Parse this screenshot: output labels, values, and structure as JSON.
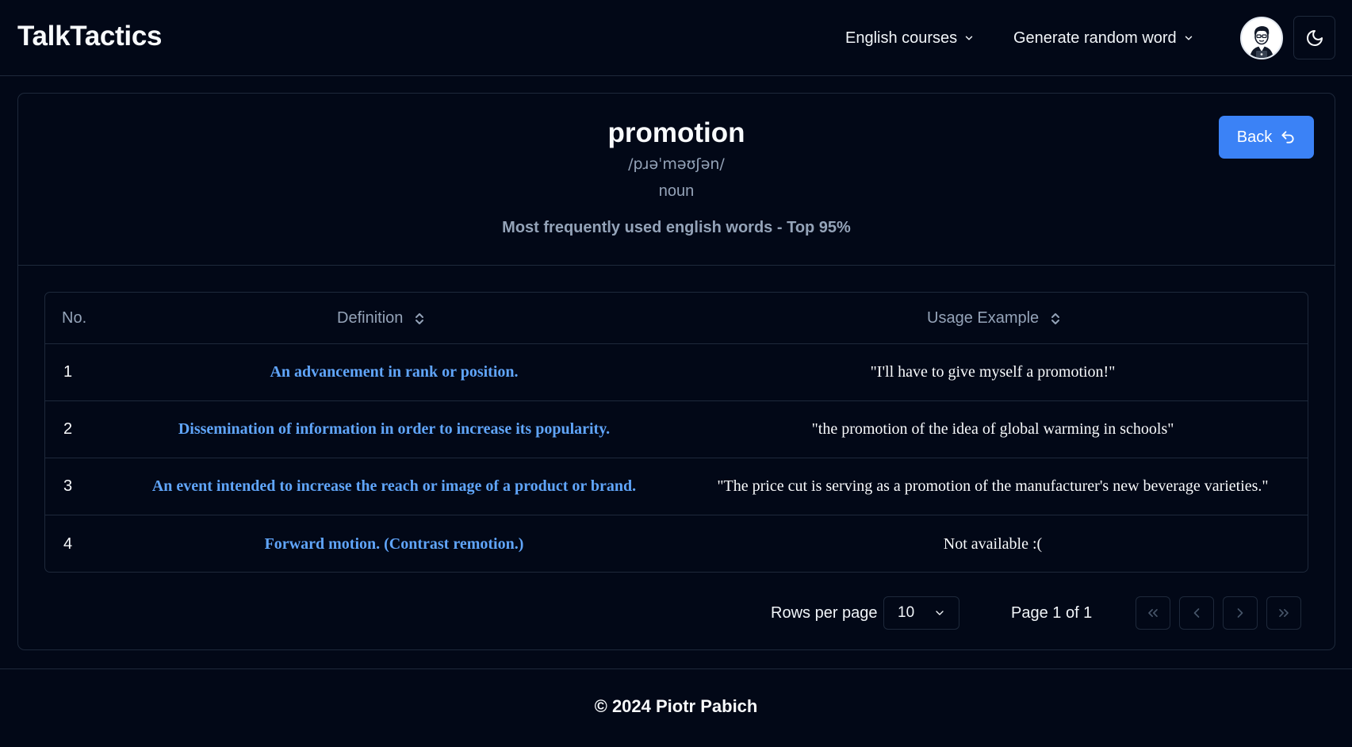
{
  "app": {
    "title": "TalkTactics"
  },
  "nav": {
    "courses_label": "English courses",
    "random_label": "Generate random word"
  },
  "icons": {
    "avatar": "user-avatar-illustration",
    "theme": "moon-icon",
    "back": "undo-arrow-icon",
    "sort": "chevrons-up-down-icon"
  },
  "colors": {
    "background": "#020817",
    "border": "#1e293b",
    "accent": "#3b82f6",
    "definition_text": "#60a5fa",
    "muted_text": "#94a3b8"
  },
  "word": {
    "term": "promotion",
    "phonetic": "/pɹəˈməʊʃən/",
    "part_of_speech": "noun",
    "frequency": "Most frequently used english words - Top 95%",
    "back_label": "Back"
  },
  "table": {
    "headers": {
      "no": "No.",
      "definition": "Definition",
      "usage": "Usage Example"
    },
    "rows": [
      {
        "no": "1",
        "definition": "An advancement in rank or position.",
        "usage": "\"I'll have to give myself a promotion!\""
      },
      {
        "no": "2",
        "definition": "Dissemination of information in order to increase its popularity.",
        "usage": "\"the promotion of the idea of global warming in schools\""
      },
      {
        "no": "3",
        "definition": "An event intended to increase the reach or image of a product or brand.",
        "usage": "\"The price cut is serving as a promotion of the manufacturer's new beverage varieties.\""
      },
      {
        "no": "4",
        "definition": "Forward motion. (Contrast remotion.)",
        "usage": "Not available :("
      }
    ]
  },
  "pagination": {
    "rows_per_page_label": "Rows per page",
    "rows_per_page_value": "10",
    "page_label": "Page 1 of 1"
  },
  "footer": {
    "text": "© 2024 Piotr Pabich"
  }
}
